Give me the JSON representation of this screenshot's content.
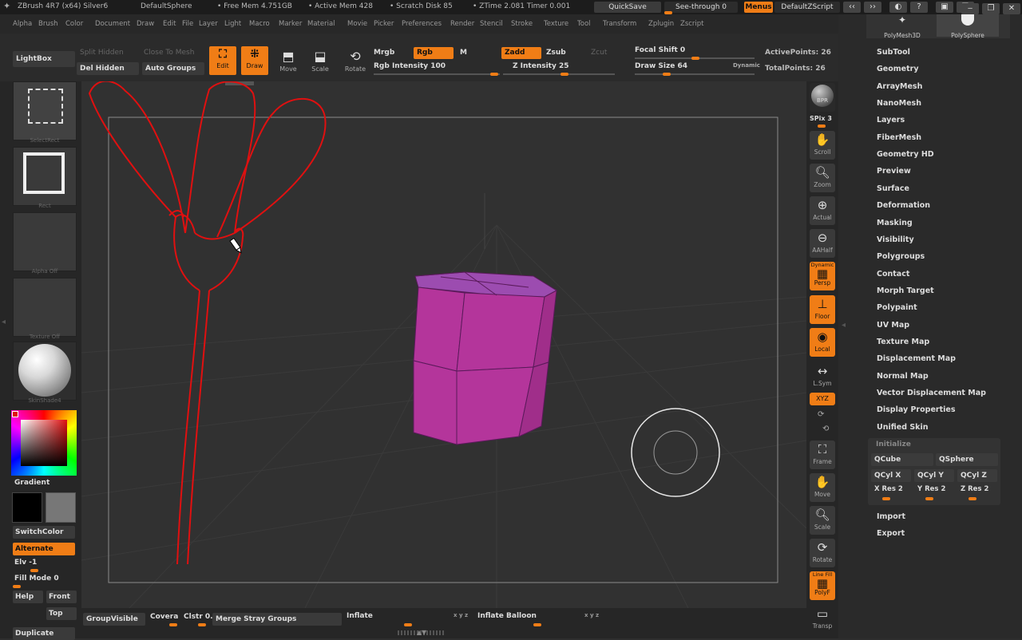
{
  "titlebar": {
    "app": "ZBrush 4R7 (x64) Silver6",
    "doc": "DefaultSphere",
    "free_mem": "• Free Mem 4.751GB",
    "active_mem": "• Active Mem 428",
    "scratch": "• Scratch Disk 85",
    "ztime": "• ZTime 2.081  Timer 0.001",
    "quicksave": "QuickSave",
    "see_through": "See-through  0",
    "menus": "Menus",
    "script": "DefaultZScript"
  },
  "menubar": [
    "Alpha",
    "Brush",
    "Color",
    "Document",
    "Draw",
    "Edit",
    "File",
    "Layer",
    "Light",
    "Macro",
    "Marker",
    "Material",
    "Movie",
    "Picker",
    "Preferences",
    "Render",
    "Stencil",
    "Stroke",
    "Texture",
    "Tool",
    "Transform",
    "Zplugin",
    "Zscript"
  ],
  "toolbar": {
    "lightbox": "LightBox",
    "split_hidden": "Split Hidden",
    "close_to_mesh": "Close To Mesh",
    "del_hidden": "Del Hidden",
    "auto_groups": "Auto Groups",
    "edit": "Edit",
    "draw": "Draw",
    "move": "Move",
    "scale": "Scale",
    "rotate": "Rotate",
    "mrgb": "Mrgb",
    "rgb": "Rgb",
    "m": "M",
    "rgb_intensity": "Rgb Intensity 100",
    "zadd": "Zadd",
    "zsub": "Zsub",
    "zcut": "Zcut",
    "z_intensity": "Z Intensity 25",
    "focal_shift": "Focal Shift 0",
    "draw_size": "Draw Size 64",
    "dynamic": "Dynamic",
    "active_points": "ActivePoints: 26",
    "total_points": "TotalPoints: 26"
  },
  "leftpanel": {
    "select_rect": "SelectRect",
    "rect": "Rect",
    "alpha_off": "Alpha  Off",
    "texture_off": "Texture  Off",
    "skinshade": "SkinShade4",
    "gradient": "Gradient",
    "switchcolor": "SwitchColor",
    "alternate": "Alternate",
    "elv": "Elv -1",
    "fill_mode": "Fill Mode 0",
    "help": "Help",
    "front": "Front",
    "top": "Top",
    "duplicate": "Duplicate"
  },
  "rightshelf": {
    "bpr": "BPR",
    "spix": "SPix 3",
    "scroll": "Scroll",
    "zoom": "Zoom",
    "actual": "Actual",
    "aahalf": "AAHalf",
    "dynamic": "Dynamic",
    "persp": "Persp",
    "floor": "Floor",
    "local": "Local",
    "lsym": "L.Sym",
    "xyz": "XYZ",
    "frame": "Frame",
    "move": "Move",
    "scale": "Scale",
    "rotate": "Rotate",
    "linefill": "Line Fill",
    "polyf": "PolyF",
    "transp": "Transp"
  },
  "tray": {
    "polymesh3d": "PolyMesh3D",
    "polysphere": "PolySphere",
    "items": [
      "SubTool",
      "Geometry",
      "ArrayMesh",
      "NanoMesh",
      "Layers",
      "FiberMesh",
      "Geometry HD",
      "Preview",
      "Surface",
      "Deformation",
      "Masking",
      "Visibility",
      "Polygroups",
      "Contact",
      "Morph Target",
      "Polypaint",
      "UV Map",
      "Texture Map",
      "Displacement Map",
      "Normal Map",
      "Vector Displacement Map",
      "Display Properties",
      "Unified Skin"
    ],
    "initialize": "Initialize",
    "qcube": "QCube",
    "qsphere": "QSphere",
    "qcylx": "QCyl X",
    "qcyly": "QCyl Y",
    "qcylz": "QCyl Z",
    "xres": "X Res 2",
    "yres": "Y Res 2",
    "zres": "Z Res 2",
    "import": "Import",
    "export": "Export"
  },
  "bottombar": {
    "groupvisible": "GroupVisible",
    "coverage": "Covera",
    "clstr": "Clstr 0.",
    "merge_stray": "Merge Stray Groups",
    "inflate": "Inflate",
    "inflate_xyz": "x y z",
    "inflate_balloon": "Inflate Balloon",
    "balloon_xyz": "x y z"
  },
  "colors": {
    "accent": "#f07d16",
    "mesh_fill": "#b4359b",
    "mesh_top": "#9c4cb0",
    "sketch": "#e01010"
  }
}
